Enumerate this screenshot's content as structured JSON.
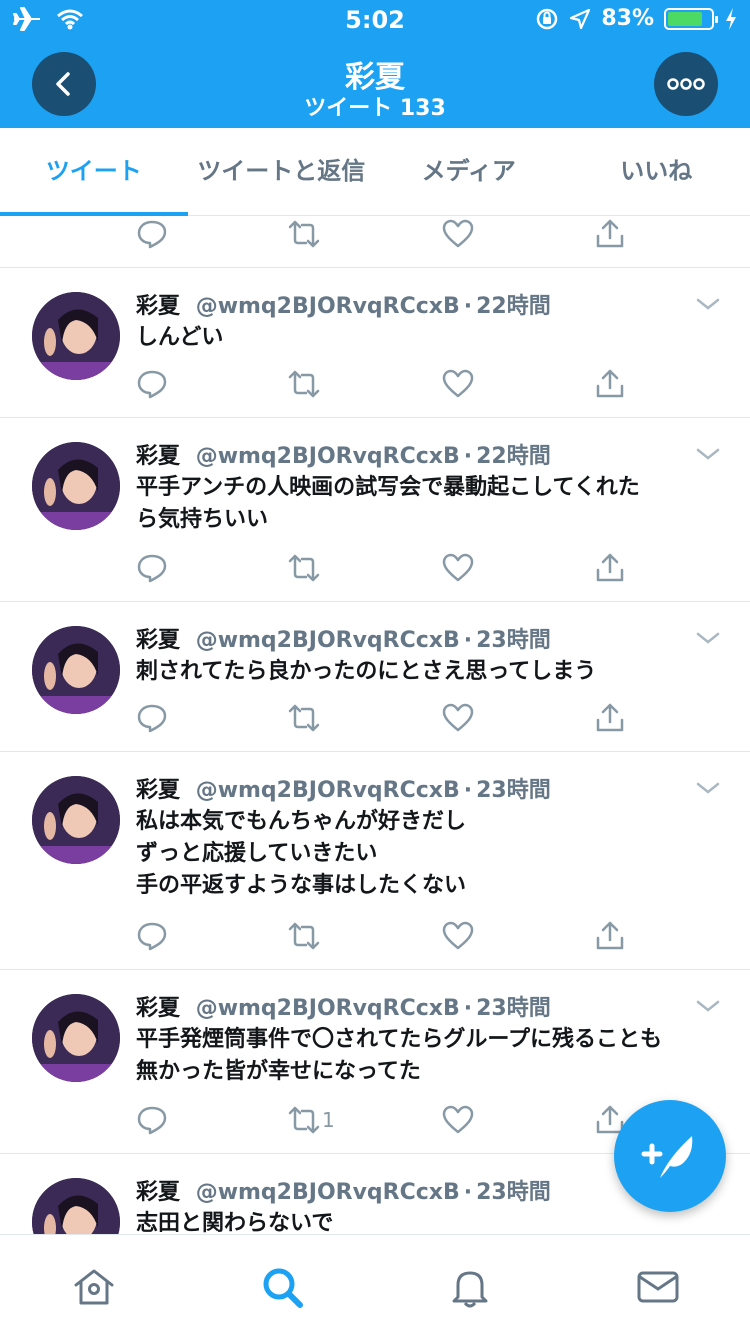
{
  "status_bar": {
    "time": "5:02",
    "battery_percent": "83%",
    "battery_level": 0.83,
    "icons": [
      "airplane-icon",
      "wifi-icon",
      "rotation-lock-icon",
      "location-arrow-icon",
      "battery-icon",
      "charging-bolt-icon"
    ]
  },
  "header": {
    "title": "彩夏",
    "subtitle": "ツイート 133",
    "back_icon": "chevron-left-icon",
    "more_icon": "ellipsis-icon",
    "color": "#1da1f2"
  },
  "tabs": [
    {
      "label": "ツイート",
      "active": true
    },
    {
      "label": "ツイートと返信",
      "active": false
    },
    {
      "label": "メディア",
      "active": false
    },
    {
      "label": "いいね",
      "active": false
    }
  ],
  "tweets": [
    {
      "name": "彩夏",
      "handle": "@wmq2BJORvqRCcxB",
      "time": "22時間",
      "lines": [
        "しんどい"
      ],
      "retweets": ""
    },
    {
      "name": "彩夏",
      "handle": "@wmq2BJORvqRCcxB",
      "time": "22時間",
      "lines": [
        "平手アンチの人映画の試写会で暴動起こしてくれた",
        "ら気持ちいい"
      ],
      "retweets": ""
    },
    {
      "name": "彩夏",
      "handle": "@wmq2BJORvqRCcxB",
      "time": "23時間",
      "lines": [
        "刺されてたら良かったのにとさえ思ってしまう"
      ],
      "retweets": ""
    },
    {
      "name": "彩夏",
      "handle": "@wmq2BJORvqRCcxB",
      "time": "23時間",
      "lines": [
        "私は本気でもんちゃんが好きだし",
        "ずっと応援していきたい",
        "手の平返すような事はしたくない"
      ],
      "retweets": ""
    },
    {
      "name": "彩夏",
      "handle": "@wmq2BJORvqRCcxB",
      "time": "23時間",
      "lines": [
        "平手発煙筒事件で〇されてたらグループに残ることも",
        "無かった皆が幸せになってた"
      ],
      "retweets": "1"
    },
    {
      "name": "彩夏",
      "handle": "@wmq2BJORvqRCcxB",
      "time": "23時間",
      "lines": [
        "志田と関わらないで"
      ],
      "retweets": ""
    }
  ],
  "fab": {
    "icon": "compose-tweet-icon"
  },
  "bottom_nav": [
    {
      "name": "home",
      "icon": "home-icon",
      "active": false
    },
    {
      "name": "search",
      "icon": "search-icon",
      "active": true
    },
    {
      "name": "notifications",
      "icon": "bell-icon",
      "active": false
    },
    {
      "name": "messages",
      "icon": "mail-icon",
      "active": false
    }
  ],
  "colors": {
    "accent": "#1da1f2",
    "muted": "#657786",
    "icon_gray": "#8899a6",
    "border": "#e1e8ed"
  }
}
